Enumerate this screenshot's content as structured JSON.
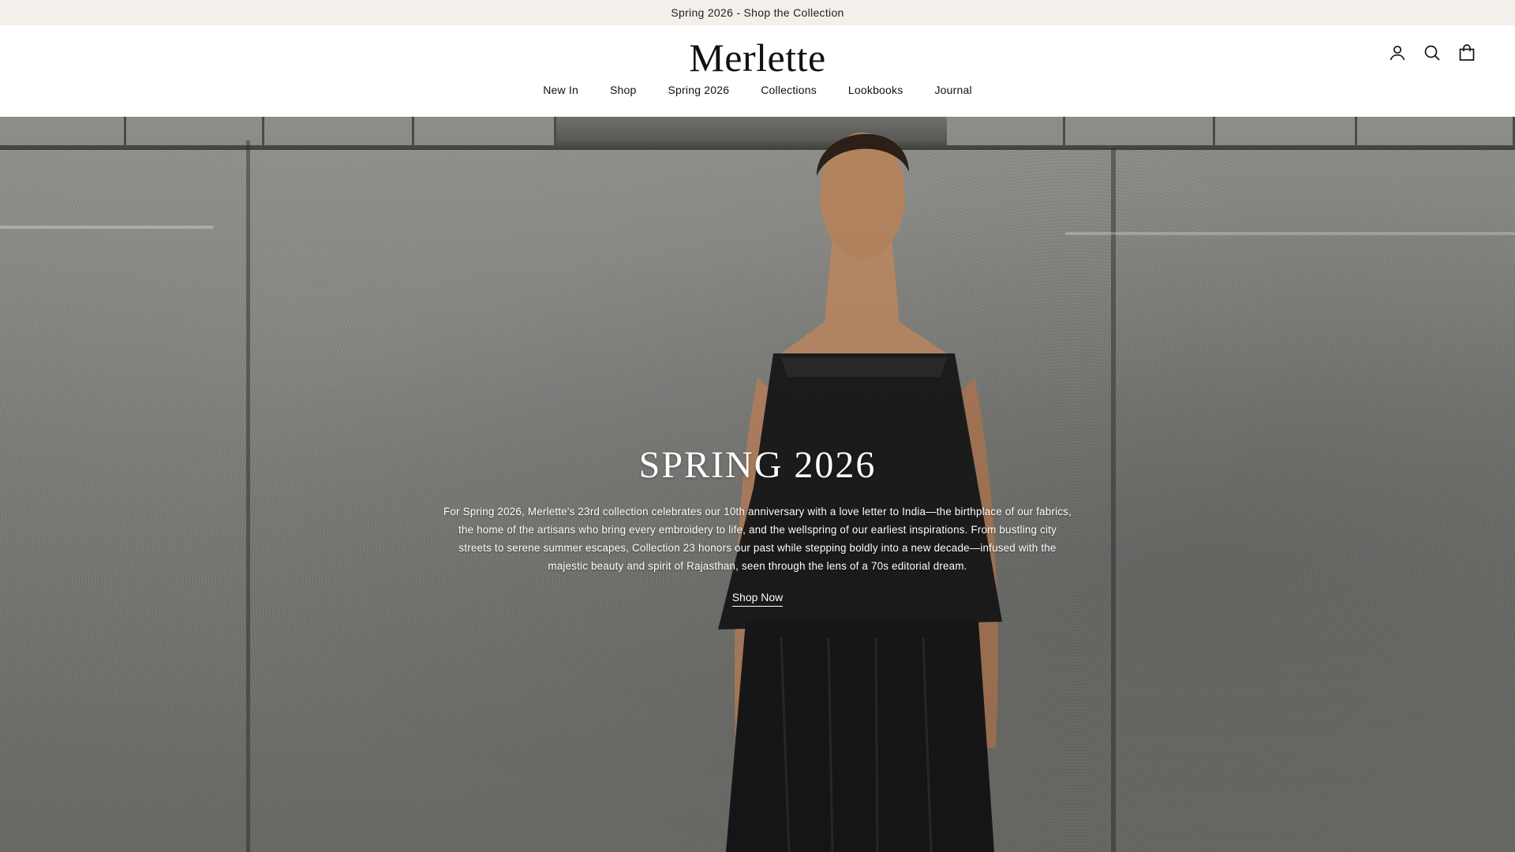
{
  "announcement": {
    "text": "Spring 2026 - Shop the Collection"
  },
  "header": {
    "logo": "Merlette",
    "icons": [
      "account-icon",
      "search-icon",
      "bag-icon"
    ]
  },
  "nav": {
    "items": [
      {
        "label": "New In"
      },
      {
        "label": "Shop"
      },
      {
        "label": "Spring 2026"
      },
      {
        "label": "Collections"
      },
      {
        "label": "Lookbooks"
      },
      {
        "label": "Journal"
      }
    ]
  },
  "hero": {
    "title": "SPRING 2026",
    "description": "For Spring 2026, Merlette's 23rd collection celebrates our 10th anniversary with a love letter to India—the birthplace of our fabrics, the home of the artisans who bring every embroidery to life, and the wellspring of our earliest inspirations. From bustling city streets to serene summer escapes, Collection 23 honors our past while stepping boldly into a new decade—infused with the majestic beauty and spirit of Rajasthan, seen through the lens of a 70s editorial dream.",
    "cta_label": "Shop Now"
  },
  "colors": {
    "announcement_bg": "#f3efeb",
    "header_bg": "#ffffff",
    "text": "#111111",
    "hero_text": "#ffffff"
  }
}
